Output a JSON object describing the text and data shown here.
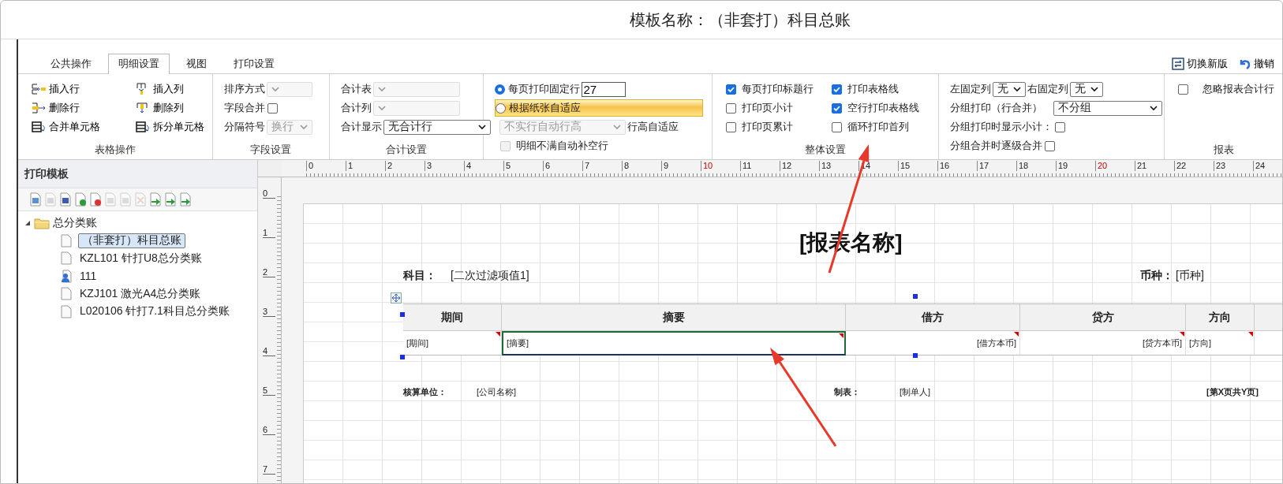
{
  "window": {
    "title": "模板名称：（非套打）科目总账"
  },
  "tabs": [
    {
      "label": "公共操作",
      "selected": false
    },
    {
      "label": "明细设置",
      "selected": true
    },
    {
      "label": "视图",
      "selected": false
    },
    {
      "label": "打印设置",
      "selected": false
    }
  ],
  "top_actions": [
    {
      "label": "切换新版"
    },
    {
      "label": "撤销"
    }
  ],
  "ribbon": [
    {
      "label": "表格操作",
      "kind": "buttons",
      "buttons": [
        {
          "label": "插入行"
        },
        {
          "label": "插入列"
        },
        {
          "label": "删除行"
        },
        {
          "label": "删除列"
        },
        {
          "label": "合并单元格"
        },
        {
          "label": "拆分单元格"
        }
      ]
    },
    {
      "label": "字段设置",
      "kind": "form",
      "rows": [
        {
          "items": [
            {
              "kind": "text",
              "text": "排序方式"
            },
            {
              "kind": "select",
              "disabled": true
            }
          ]
        },
        {
          "items": [
            {
              "kind": "text",
              "text": "字段合并"
            },
            {
              "kind": "checkbox",
              "checked": false
            }
          ]
        },
        {
          "items": [
            {
              "kind": "text",
              "text": "分隔符号"
            },
            {
              "kind": "select",
              "value": "换行",
              "disabled": true
            }
          ]
        }
      ]
    },
    {
      "label": "合计设置",
      "kind": "form",
      "rows": [
        {
          "items": [
            {
              "kind": "text",
              "text": "合计表"
            },
            {
              "kind": "select",
              "disabled": true
            }
          ]
        },
        {
          "items": [
            {
              "kind": "text",
              "text": "合计列"
            },
            {
              "kind": "select",
              "disabled": true
            }
          ]
        },
        {
          "items": [
            {
              "kind": "text",
              "text": "合计显示"
            },
            {
              "kind": "select",
              "value": "无合计行",
              "disabled": false
            }
          ]
        }
      ]
    },
    {
      "kind": "form",
      "rows": [
        {
          "items": [
            {
              "kind": "radio",
              "label": "每页打印固定行",
              "selected": true,
              "highlighted": false
            },
            {
              "kind": "input",
              "value": "27"
            }
          ]
        },
        {
          "items": [
            {
              "kind": "radio",
              "label": "根据纸张自适应",
              "selected": false,
              "highlighted": true
            }
          ]
        },
        {
          "items": [
            {
              "kind": "select",
              "value": "不实行自动行高",
              "disabled": true
            },
            {
              "kind": "text",
              "text": "行高自适应"
            }
          ]
        },
        {
          "items": [
            {
              "kind": "checkbox",
              "label": "明细不满自动补空行",
              "checked": false,
              "disabled": true
            }
          ]
        }
      ]
    },
    {
      "label": "整体设置",
      "kind": "form",
      "rows": [
        {
          "items": [
            {
              "kind": "checkbox",
              "label": "每页打印标题行",
              "checked": true
            },
            {
              "kind": "checkbox",
              "label": "打印表格线",
              "checked": true
            }
          ]
        },
        {
          "items": [
            {
              "kind": "checkbox",
              "label": "打印页小计",
              "checked": false
            },
            {
              "kind": "checkbox",
              "label": "空行打印表格线",
              "checked": true
            }
          ]
        },
        {
          "items": [
            {
              "kind": "checkbox",
              "label": "打印页累计",
              "checked": false
            },
            {
              "kind": "checkbox",
              "label": "循环打印首列",
              "checked": false
            }
          ]
        }
      ]
    },
    {
      "kind": "form",
      "rows": [
        {
          "items": [
            {
              "kind": "text",
              "text": "左固定列"
            },
            {
              "kind": "select",
              "value": "无",
              "disabled": false
            },
            {
              "kind": "text",
              "text": "右固定列"
            },
            {
              "kind": "select",
              "value": "无",
              "disabled": false
            }
          ]
        },
        {
          "items": [
            {
              "kind": "text",
              "text": "分组打印（行合并）"
            },
            {
              "kind": "select",
              "value": "不分组",
              "disabled": false
            }
          ]
        },
        {
          "items": [
            {
              "kind": "text",
              "text": "分组打印时显示小计："
            },
            {
              "kind": "checkbox",
              "checked": false
            }
          ]
        },
        {
          "items": [
            {
              "kind": "text",
              "text": "分组合并时逐级合并"
            },
            {
              "kind": "checkbox",
              "checked": false
            }
          ]
        }
      ]
    },
    {
      "label": "报表",
      "kind": "form",
      "rows": [
        {
          "items": [
            {
              "kind": "checkbox",
              "label": "忽略报表合计行",
              "checked": false
            }
          ]
        }
      ]
    }
  ],
  "template_panel": {
    "title": "打印模板",
    "tree": [
      {
        "label": "总分类账",
        "expanded": true,
        "children": [
          {
            "label": "（非套打）科目总账",
            "kind": "file",
            "selected": true
          },
          {
            "label": "KZL101 针打U8总分类账",
            "kind": "file",
            "selected": false
          },
          {
            "label": "111",
            "kind": "user",
            "selected": false
          },
          {
            "label": "KZJ101 激光A4总分类账",
            "kind": "file",
            "selected": false
          },
          {
            "label": "L020106 针打7.1科目总分类账",
            "kind": "file",
            "selected": false
          }
        ]
      }
    ]
  },
  "ruler": {
    "horizontal": [
      "0",
      "1",
      "2",
      "3",
      "4",
      "5",
      "6",
      "7",
      "8",
      "9",
      "10",
      "11",
      "12",
      "13",
      "14",
      "15",
      "16",
      "17",
      "18",
      "19",
      "20",
      "21",
      "22",
      "23",
      "24"
    ],
    "vertical": [
      "0",
      "1",
      "2",
      "3",
      "4",
      "5",
      "6",
      "7"
    ]
  },
  "report": {
    "title": "[报表名称]",
    "header": [
      {
        "label": "科目：",
        "value": "[二次过滤项值1]"
      },
      {
        "label": "币种：",
        "value": "[币种]"
      }
    ],
    "columns": [
      {
        "heading": "期间",
        "field": "[期间]",
        "selected": false
      },
      {
        "heading": "摘要",
        "field": "[摘要]",
        "selected": true
      },
      {
        "heading": "借方",
        "field": "[借方本币]",
        "selected": false
      },
      {
        "heading": "贷方",
        "field": "[贷方本币]",
        "selected": false
      },
      {
        "heading": "方向",
        "field": "[方向]",
        "selected": false
      }
    ],
    "footer": [
      {
        "label": "核算单位：",
        "value": "[公司名称]"
      },
      {
        "label": "制表：",
        "value": "[制单人]"
      },
      {
        "label": "[第X页共Y页]"
      }
    ]
  }
}
